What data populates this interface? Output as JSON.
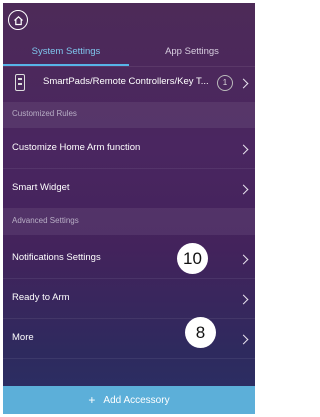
{
  "header": {
    "home_icon": "home-icon"
  },
  "tabs": [
    {
      "label": "System Settings",
      "active": true
    },
    {
      "label": "App Settings",
      "active": false
    }
  ],
  "device_row": {
    "label": "SmartPads/Remote Controllers/Key T...",
    "count": "1"
  },
  "sections": [
    {
      "header": "Customized Rules",
      "items": [
        {
          "label": "Customize Home Arm function"
        },
        {
          "label": "Smart Widget"
        }
      ]
    },
    {
      "header": "Advanced Settings",
      "items": [
        {
          "label": "Notifications Settings",
          "callout": "10"
        },
        {
          "label": "Ready to Arm"
        },
        {
          "label": "More",
          "callout": "8"
        }
      ]
    }
  ],
  "footer": {
    "add_plus": "+",
    "add_label": "Add Accessory"
  },
  "colors": {
    "accent": "#57b4e8",
    "footer_bar": "#5cafd9",
    "background": "#4a2660"
  }
}
